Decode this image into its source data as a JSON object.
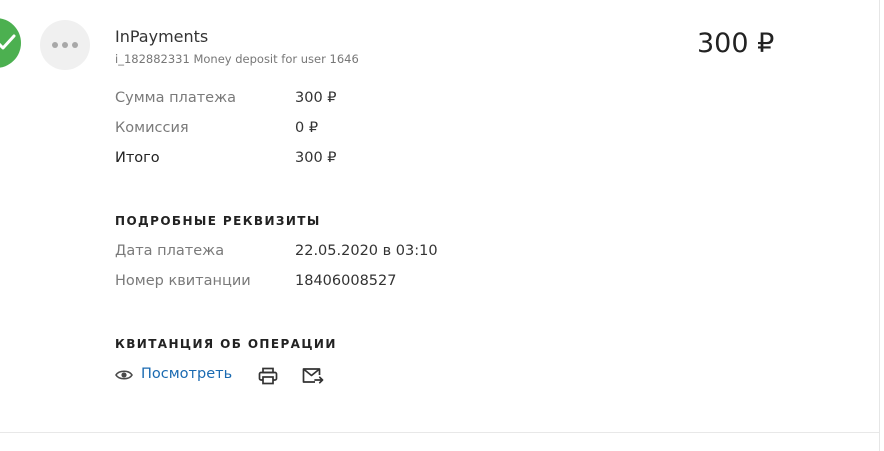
{
  "payment": {
    "merchant": "InPayments",
    "description": "i_182882331 Money deposit for user 1646",
    "total_amount": "300 ₽"
  },
  "breakdown": [
    {
      "label": "Сумма платежа",
      "value": "300 ₽"
    },
    {
      "label": "Комиссия",
      "value": "0 ₽"
    },
    {
      "label": "Итого",
      "value": "300 ₽"
    }
  ],
  "details": {
    "heading": "ПОДРОБНЫЕ РЕКВИЗИТЫ",
    "rows": [
      {
        "label": "Дата платежа",
        "value": "22.05.2020 в 03:10"
      },
      {
        "label": "Номер квитанции",
        "value": "18406008527"
      }
    ]
  },
  "receipt": {
    "heading": "КВИТАНЦИЯ ОБ ОПЕРАЦИИ",
    "view_label": "Посмотреть"
  },
  "icons": {
    "status": "checkmark-icon",
    "logo": "more-dots-icon",
    "view": "eye-icon",
    "print": "printer-icon",
    "email": "mail-forward-icon"
  },
  "colors": {
    "success": "#4cb050",
    "link": "#1a6ab1"
  }
}
